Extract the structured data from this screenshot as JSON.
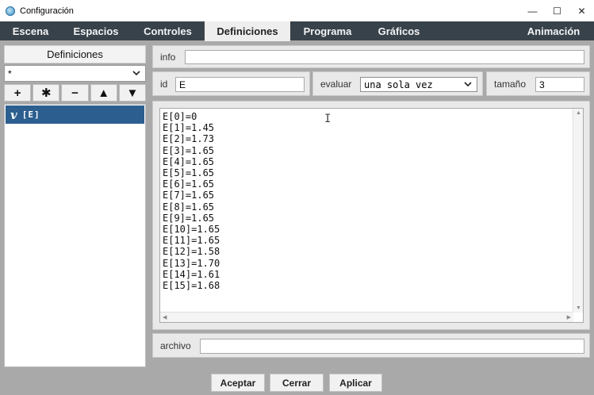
{
  "window": {
    "title": "Configuración",
    "minimize": "—",
    "maximize": "☐",
    "close": "✕"
  },
  "tabs": [
    {
      "label": "Escena"
    },
    {
      "label": "Espacios"
    },
    {
      "label": "Controles"
    },
    {
      "label": "Definiciones",
      "active": true
    },
    {
      "label": "Programa"
    },
    {
      "label": "Gráficos"
    },
    {
      "label": "Animación"
    }
  ],
  "left": {
    "header": "Definiciones",
    "filter_value": "*",
    "buttons": [
      "+",
      "✱",
      "−",
      "▲",
      "▼"
    ],
    "items": [
      {
        "icon": "v-icon",
        "label": "[E]"
      }
    ]
  },
  "fields": {
    "info_label": "info",
    "info_value": "",
    "id_label": "id",
    "id_value": "E",
    "evaluar_label": "evaluar",
    "evaluar_value": "una sola vez",
    "tamano_label": "tamaño",
    "tamano_value": "3",
    "archivo_label": "archivo",
    "archivo_value": ""
  },
  "code_lines": [
    "E[0]=0",
    "E[1]=1.45",
    "E[2]=1.73",
    "E[3]=1.65",
    "E[4]=1.65",
    "E[5]=1.65",
    "E[6]=1.65",
    "E[7]=1.65",
    "E[8]=1.65",
    "E[9]=1.65",
    "E[10]=1.65",
    "E[11]=1.65",
    "E[12]=1.58",
    "E[13]=1.70",
    "E[14]=1.61",
    "E[15]=1.68"
  ],
  "footer": {
    "accept": "Aceptar",
    "close": "Cerrar",
    "apply": "Aplicar"
  },
  "colors": {
    "tabbar": "#38424a",
    "selection": "#2c5f8f",
    "background": "#a9a9a9"
  }
}
